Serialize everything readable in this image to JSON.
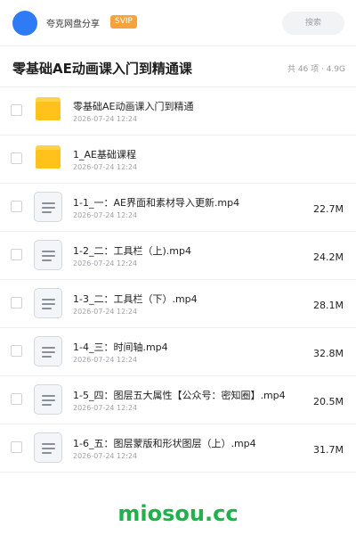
{
  "header": {
    "sharer_name": "夸克网盘分享",
    "badge": "SVIP",
    "search_placeholder": "搜索"
  },
  "share": {
    "title": "零基础AE动画课入门到精通课",
    "meta": "共 46 项 · 4.9G"
  },
  "files": [
    {
      "type": "folder",
      "name": "零基础AE动画课入门到精通",
      "date": "2026-07-24 12:24",
      "size": ""
    },
    {
      "type": "folder",
      "name": "1_AE基础课程",
      "date": "2026-07-24 12:24",
      "size": ""
    },
    {
      "type": "file",
      "name": "1-1_一：AE界面和素材导入更新.mp4",
      "date": "2026-07-24 12:24",
      "size": "22.7M"
    },
    {
      "type": "file",
      "name": "1-2_二：工具栏（上).mp4",
      "date": "2026-07-24 12:24",
      "size": "24.2M"
    },
    {
      "type": "file",
      "name": "1-3_二：工具栏（下）.mp4",
      "date": "2026-07-24 12:24",
      "size": "28.1M"
    },
    {
      "type": "file",
      "name": "1-4_三：时间轴.mp4",
      "date": "2026-07-24 12:24",
      "size": "32.8M"
    },
    {
      "type": "file",
      "name": "1-5_四：图层五大属性【公众号：密知圈】.mp4",
      "date": "2026-07-24 12:24",
      "size": "20.5M"
    },
    {
      "type": "file",
      "name": "1-6_五：图层蒙版和形状图层（上）.mp4",
      "date": "2026-07-24 12:24",
      "size": "31.7M"
    }
  ],
  "watermark": "miosou.cc",
  "colors": {
    "accent": "#2f7bf6",
    "svip": "#f7a33b",
    "folder": "#ffc21a",
    "watermark": "#1fb24a"
  },
  "icons": {
    "folder": "folder-icon",
    "file": "video-file-icon"
  }
}
